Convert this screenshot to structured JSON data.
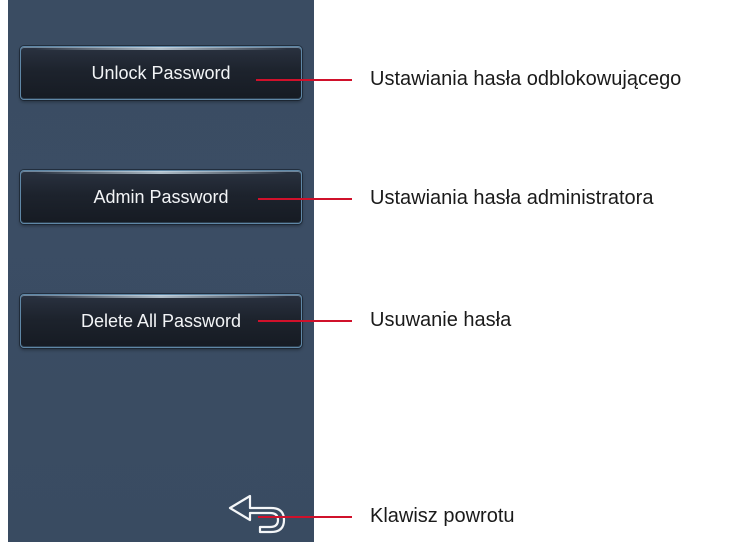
{
  "menu": {
    "buttons": [
      {
        "label": "Unlock Password"
      },
      {
        "label": "Admin Password"
      },
      {
        "label": "Delete All Password"
      }
    ]
  },
  "annotations": {
    "unlock": "Ustawiania hasła odblokowującego",
    "admin": "Ustawiania hasła administratora",
    "delete": "Usuwanie hasła",
    "back": "Klawisz powrotu"
  },
  "colors": {
    "panel_background": "#3a4c62",
    "button_fill": "#1d232d",
    "button_border": "#5f87a6",
    "leader_line": "#d0112b"
  },
  "icons": {
    "back": "return-arrow-icon"
  }
}
